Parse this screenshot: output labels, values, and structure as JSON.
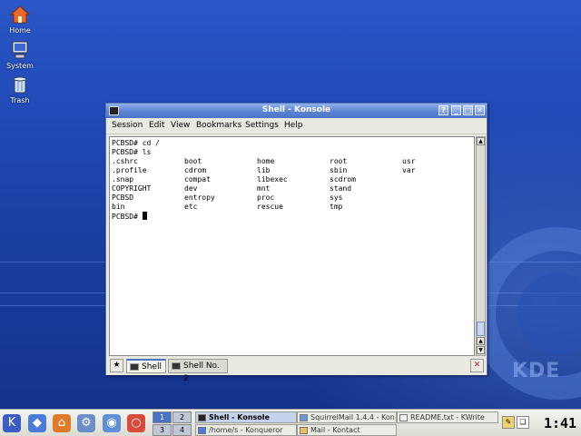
{
  "desktop": {
    "icons": [
      {
        "label": "Home",
        "icon": "home-icon"
      },
      {
        "label": "System",
        "icon": "computer-icon"
      },
      {
        "label": "Trash",
        "icon": "trash-icon"
      }
    ],
    "watermark": "KDE"
  },
  "window": {
    "title": "Shell - Konsole",
    "menu": [
      "Session",
      "Edit",
      "View",
      "Bookmarks",
      "Settings",
      "Help"
    ],
    "controls": {
      "help": "?",
      "minimize": "_",
      "maximize": "□",
      "close": "✕"
    }
  },
  "terminal": {
    "lines": [
      "PCBSD# cd /",
      "PCBSD# ls"
    ],
    "ls_rows": [
      [
        ".cshrc",
        "boot",
        "home",
        "root",
        "usr"
      ],
      [
        ".profile",
        "cdrom",
        "lib",
        "sbin",
        "var"
      ],
      [
        ".snap",
        "compat",
        "libexec",
        "scdrom",
        ""
      ],
      [
        "COPYRIGHT",
        "dev",
        "mnt",
        "stand",
        ""
      ],
      [
        "PCBSD",
        "entropy",
        "proc",
        "sys",
        ""
      ],
      [
        "bin",
        "etc",
        "rescue",
        "tmp",
        ""
      ]
    ],
    "prompt": "PCBSD# "
  },
  "tabs": [
    {
      "label": "Shell",
      "active": true
    },
    {
      "label": "Shell No. 2",
      "active": false
    }
  ],
  "taskbar": {
    "pager": [
      "1",
      "2",
      "3",
      "4"
    ],
    "tasks": [
      {
        "label": "Shell - Konsole",
        "active": true
      },
      {
        "label": "SquirrelMail 1.4.4 - Kon",
        "active": false
      },
      {
        "label": "README.txt - KWrite",
        "active": false
      },
      {
        "label": "/home/s - Konqueror",
        "active": false
      },
      {
        "label": "Mail - Kontact",
        "active": false
      }
    ],
    "clock": "1:41"
  },
  "colors": {
    "desktop": "#1f48b4",
    "titlebar": "#5e86d6",
    "active_tab": "#4a73c8"
  }
}
